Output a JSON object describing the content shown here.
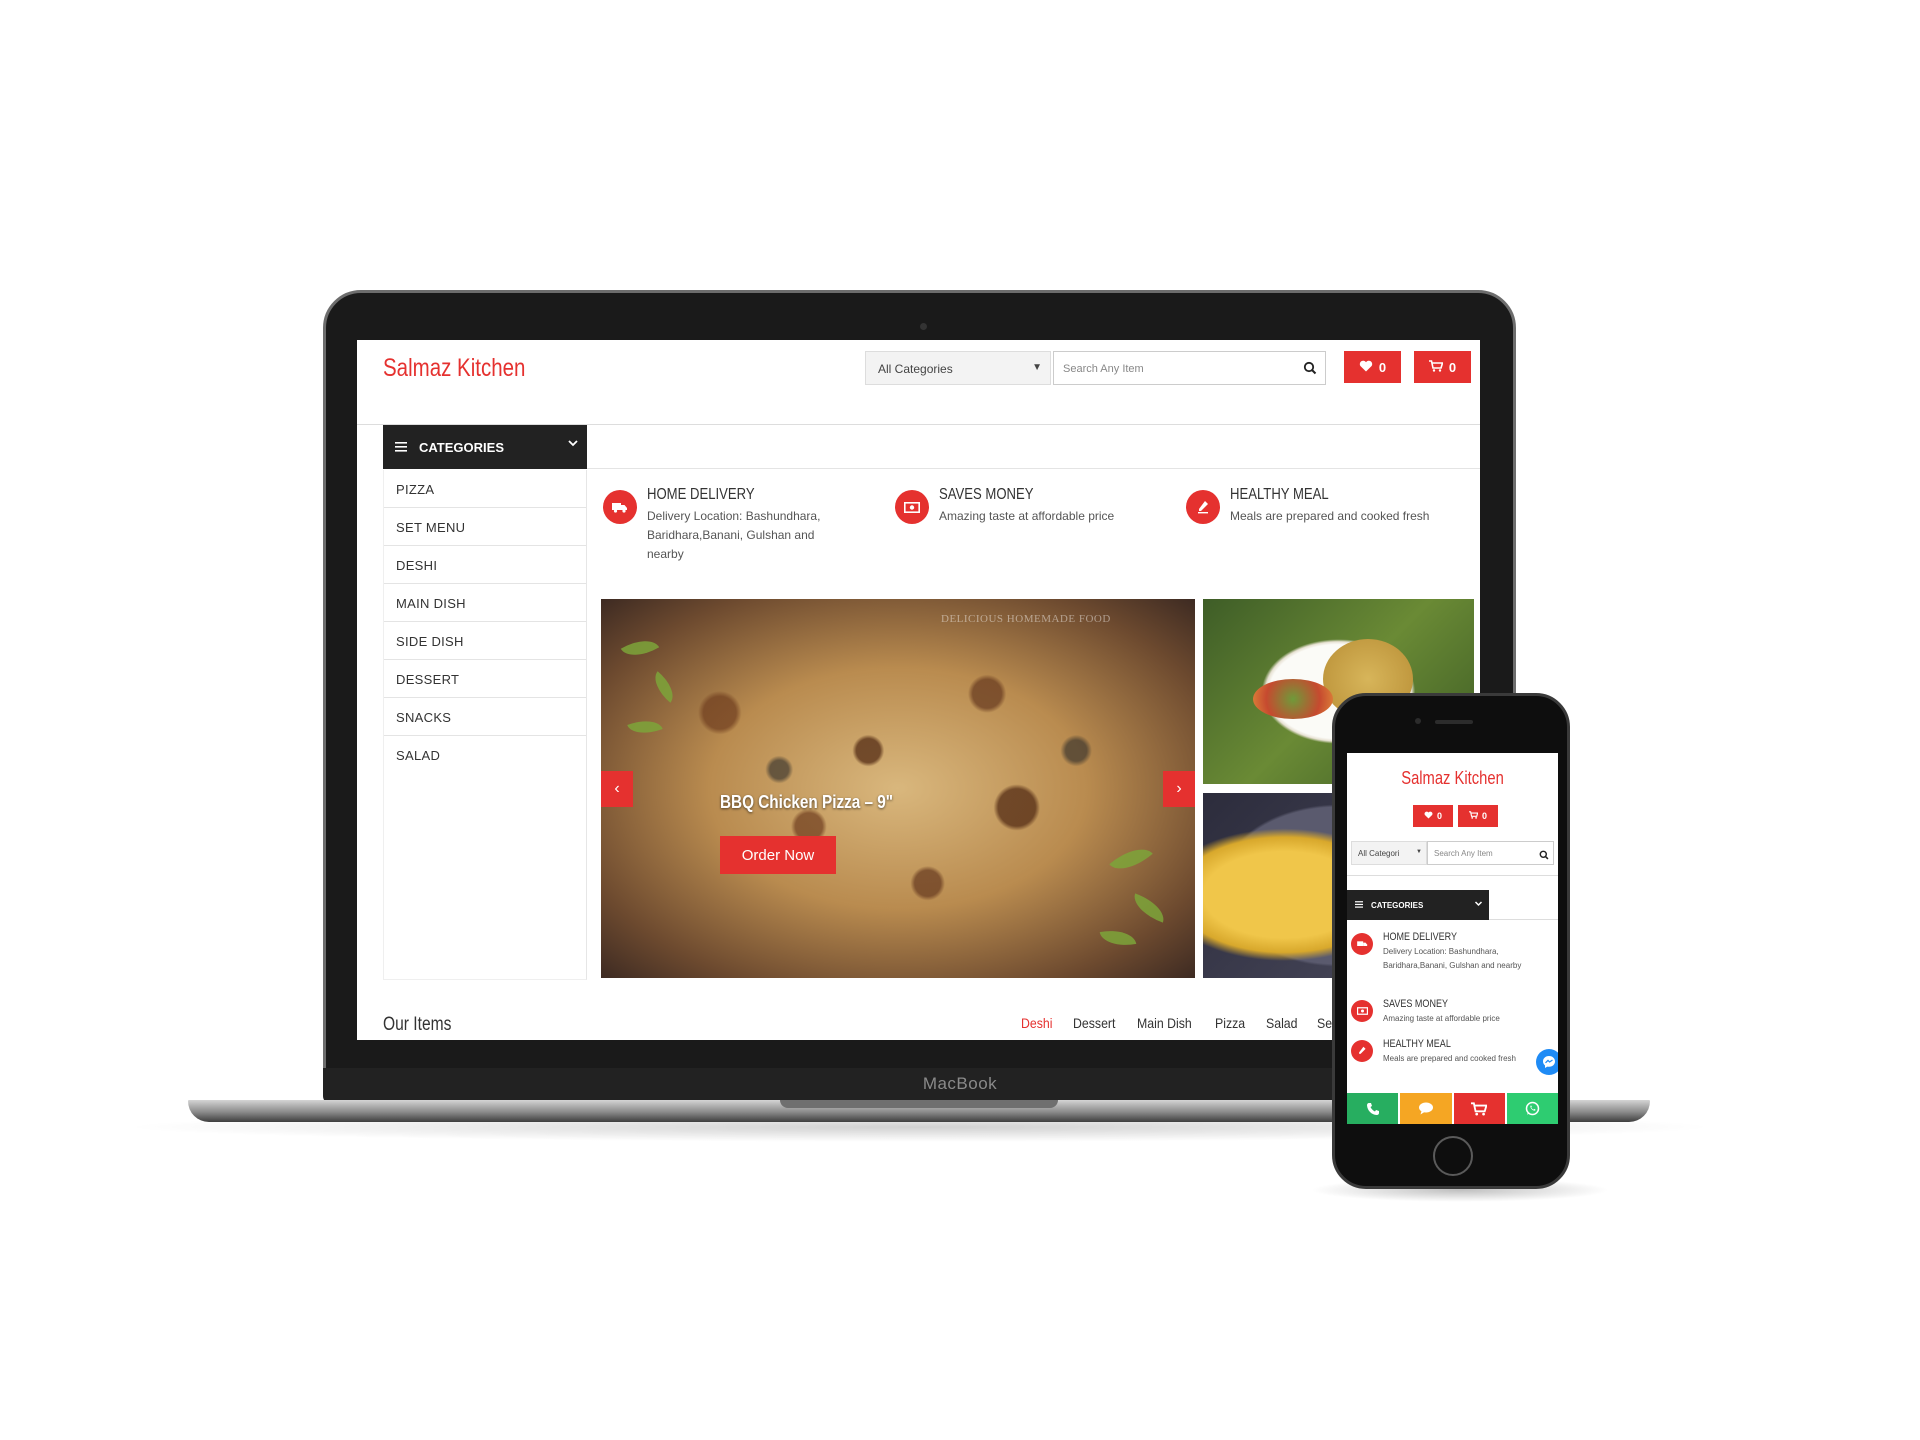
{
  "laptop": {
    "brand_label": "MacBook",
    "header": {
      "logo": "Salmaz Kitchen",
      "category_select": "All Categories",
      "search_placeholder": "Search Any Item",
      "wishlist_count": "0",
      "cart_count": "0"
    },
    "categories": {
      "title": "CATEGORIES",
      "items": [
        "PIZZA",
        "SET MENU",
        "DESHI",
        "MAIN DISH",
        "SIDE DISH",
        "DESSERT",
        "SNACKS",
        "SALAD"
      ]
    },
    "features": [
      {
        "title": "HOME DELIVERY",
        "text": "Delivery Location: Bashundhara, Baridhara,Banani, Gulshan and nearby",
        "icon": "truck-icon"
      },
      {
        "title": "SAVES MONEY",
        "text": "Amazing taste at affordable price",
        "icon": "money-icon"
      },
      {
        "title": "HEALTHY MEAL",
        "text": "Meals are prepared and cooked fresh",
        "icon": "chef-icon"
      }
    ],
    "slider": {
      "title": "BBQ Chicken Pizza – 9\"",
      "button": "Order Now",
      "watermark": "DELICIOUS HOMEMADE FOOD",
      "prev": "‹",
      "next": "›"
    },
    "our_items": {
      "title": "Our Items",
      "tabs": [
        "Deshi",
        "Dessert",
        "Main Dish",
        "Pizza",
        "Salad",
        "Set Menu"
      ],
      "active_tab": "Deshi"
    }
  },
  "phone": {
    "logo": "Salmaz Kitchen",
    "wishlist_count": "0",
    "cart_count": "0",
    "category_select": "All Categori",
    "search_placeholder": "Search Any Item",
    "categories_title": "CATEGORIES",
    "features": [
      {
        "title": "HOME DELIVERY",
        "text": "Delivery Location: Bashundhara, Baridhara,Banani, Gulshan and nearby"
      },
      {
        "title": "SAVES MONEY",
        "text": "Amazing taste at affordable price"
      },
      {
        "title": "HEALTHY MEAL",
        "text": "Meals are prepared and cooked fresh"
      }
    ],
    "bottom_bar": [
      {
        "icon": "phone-icon",
        "color": "#27ae60"
      },
      {
        "icon": "chat-icon",
        "color": "#f5a623"
      },
      {
        "icon": "cart-icon",
        "color": "#e5312f"
      },
      {
        "icon": "whatsapp-icon",
        "color": "#2ecc71"
      }
    ]
  },
  "colors": {
    "accent": "#e5312f",
    "dark": "#222222",
    "messenger": "#1f8bf5"
  }
}
